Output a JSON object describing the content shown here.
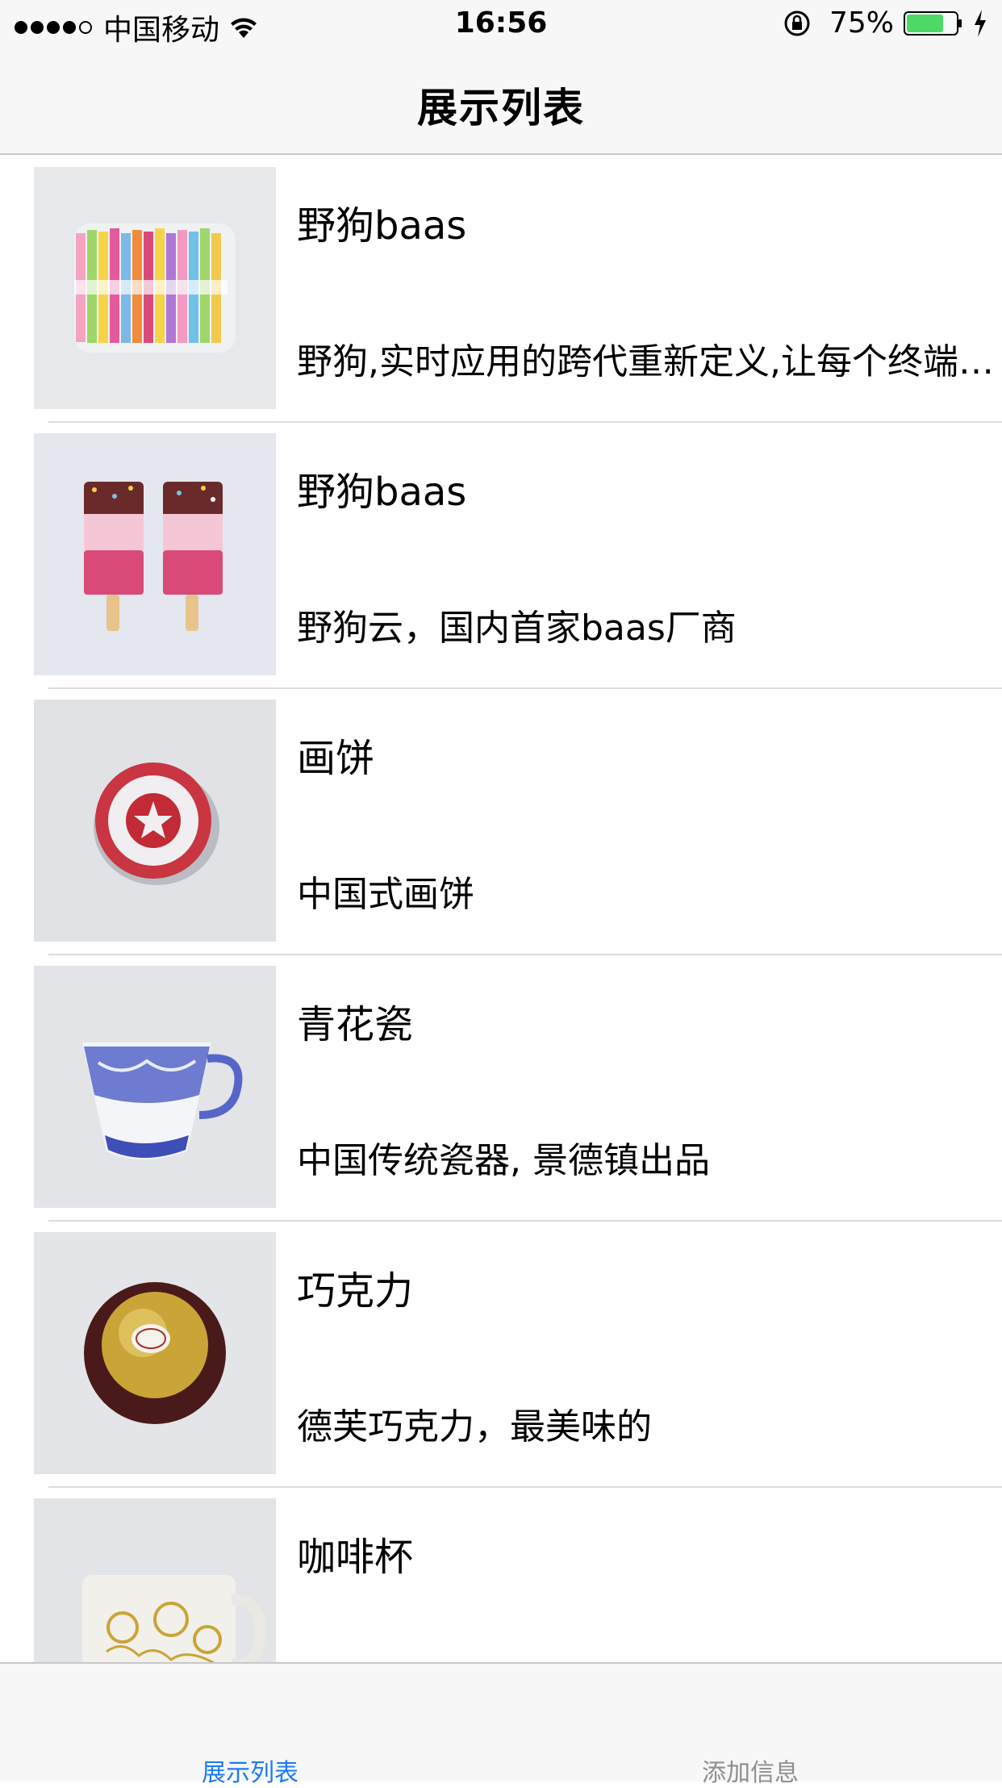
{
  "status_bar": {
    "carrier": "中国移动",
    "time": "16:56",
    "battery_percent": "75%",
    "battery_level": 0.75
  },
  "nav": {
    "title": "展示列表"
  },
  "items": [
    {
      "title": "野狗baas",
      "subtitle": "野狗,实时应用的跨代重新定义,让每个终端…",
      "image_icon": "candy-sticks-image"
    },
    {
      "title": "野狗baas",
      "subtitle": "野狗云，国内首家baas厂商",
      "image_icon": "popsicles-image"
    },
    {
      "title": "画饼",
      "subtitle": "中国式画饼",
      "image_icon": "teacake-image"
    },
    {
      "title": "青花瓷",
      "subtitle": "中国传统瓷器, 景德镇出品",
      "image_icon": "porcelain-cup-image"
    },
    {
      "title": "巧克力",
      "subtitle": "德芙巧克力，最美味的",
      "image_icon": "chocolate-image"
    },
    {
      "title": "咖啡杯",
      "subtitle": "",
      "image_icon": "coffee-cup-image"
    }
  ],
  "tabs": [
    {
      "label": "展示列表",
      "active": true
    },
    {
      "label": "添加信息",
      "active": false
    }
  ],
  "colors": {
    "accent": "#1a7cf4",
    "inactive": "#8e8e93",
    "battery": "#4cd964"
  }
}
